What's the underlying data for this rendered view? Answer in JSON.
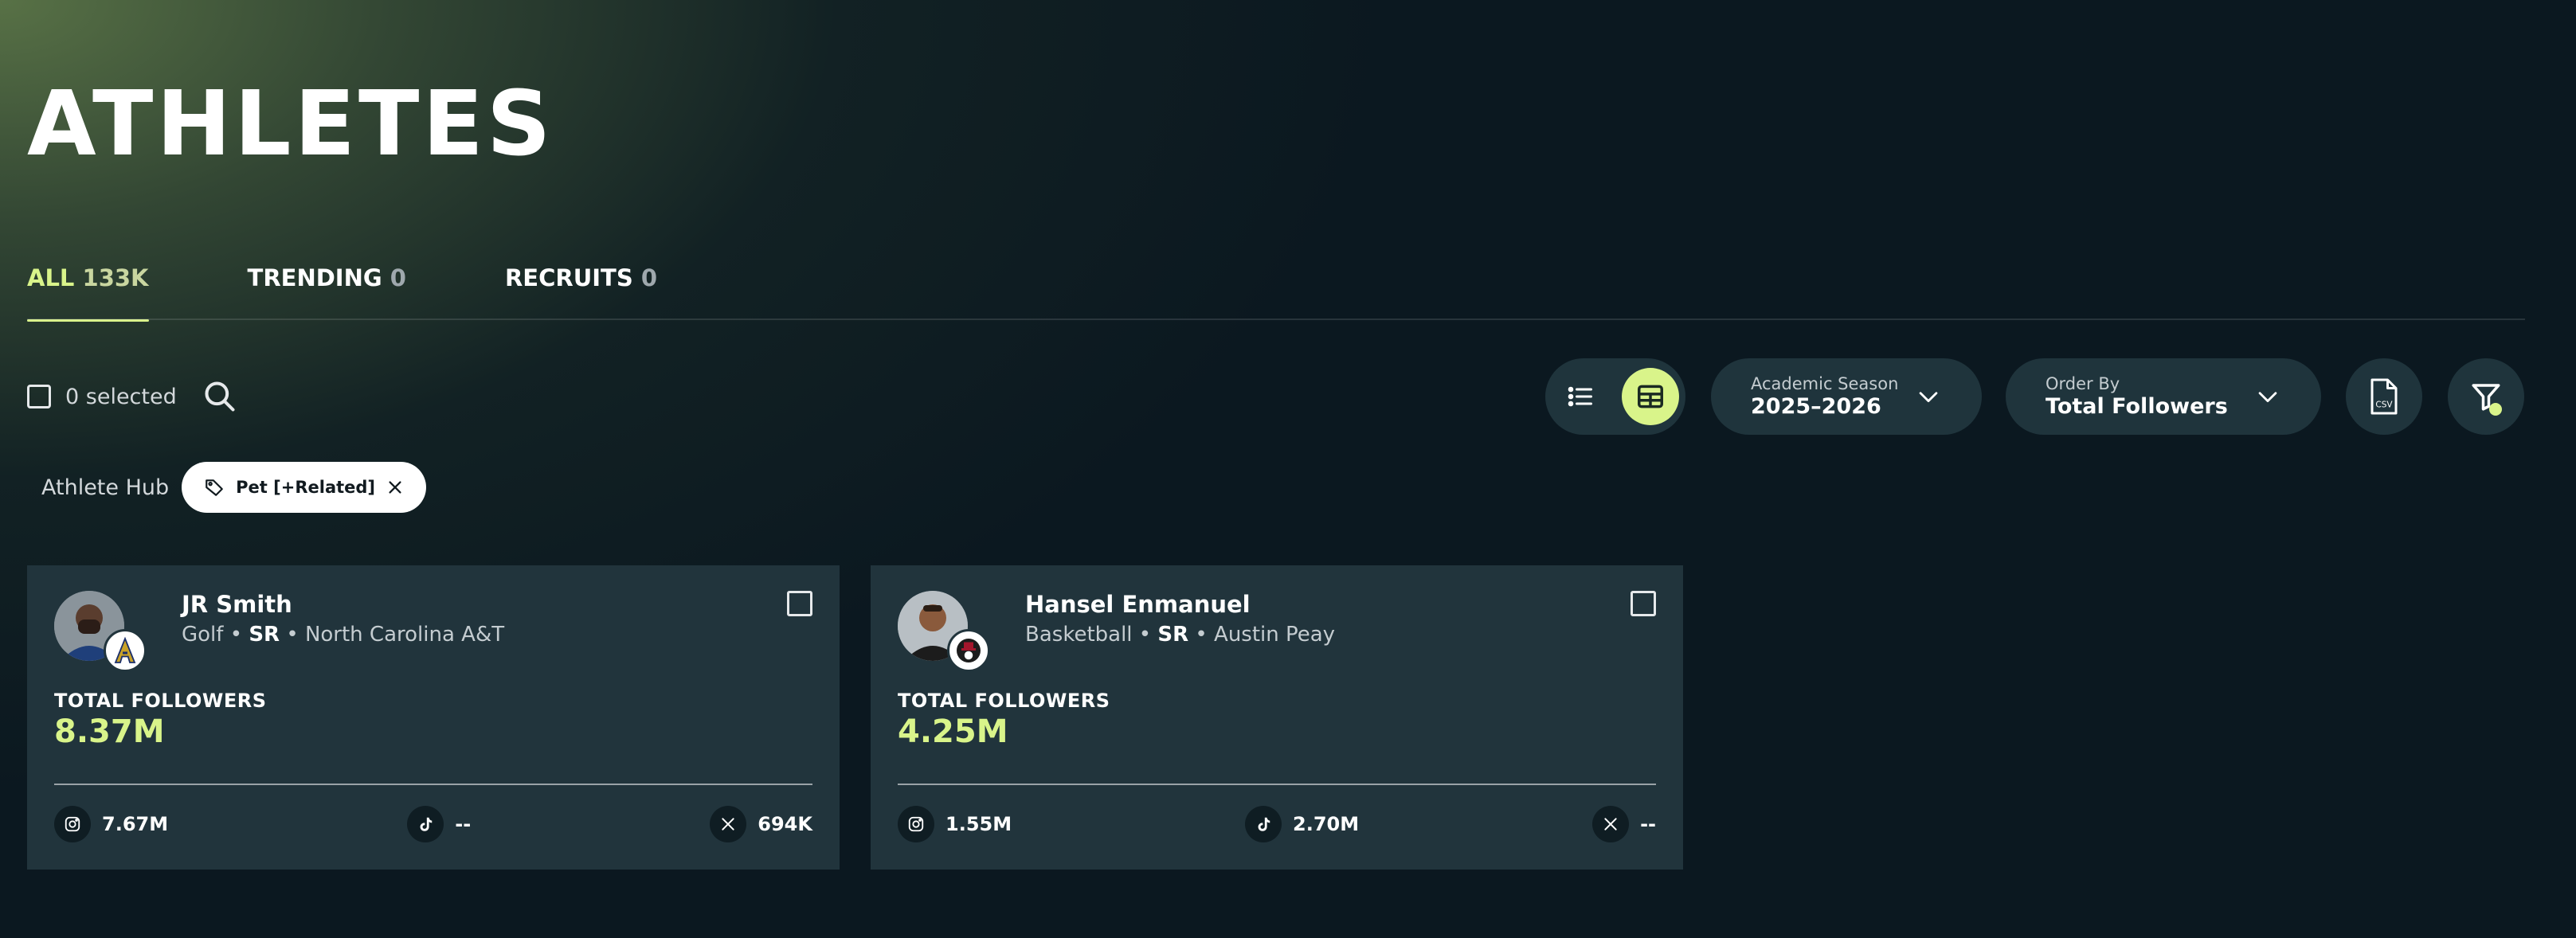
{
  "page": {
    "title": "ATHLETES"
  },
  "tabs": [
    {
      "label": "ALL",
      "count": "133K"
    },
    {
      "label": "TRENDING",
      "count": "0"
    },
    {
      "label": "RECRUITS",
      "count": "0"
    }
  ],
  "selection": {
    "text": "0 selected"
  },
  "toolbar": {
    "season_label": "Academic Season",
    "season_value": "2025–2026",
    "order_label": "Order By",
    "order_value": "Total Followers",
    "csv_label": "CSV"
  },
  "filters": {
    "hub_label": "Athlete Hub",
    "chip_label": "Pet [+Related]"
  },
  "colors": {
    "accent": "#d9f48a",
    "card_bg": "#21343c",
    "page_bg": "#0b1820"
  },
  "athletes": [
    {
      "name": "JR Smith",
      "sport": "Golf",
      "class_year": "SR",
      "school": "North Carolina A&T",
      "total_followers_label": "TOTAL FOLLOWERS",
      "total_followers": "8.37M",
      "instagram": "7.67M",
      "tiktok": "--",
      "x": "694K"
    },
    {
      "name": "Hansel Enmanuel",
      "sport": "Basketball",
      "class_year": "SR",
      "school": "Austin Peay",
      "total_followers_label": "TOTAL FOLLOWERS",
      "total_followers": "4.25M",
      "instagram": "1.55M",
      "tiktok": "2.70M",
      "x": "--"
    }
  ]
}
